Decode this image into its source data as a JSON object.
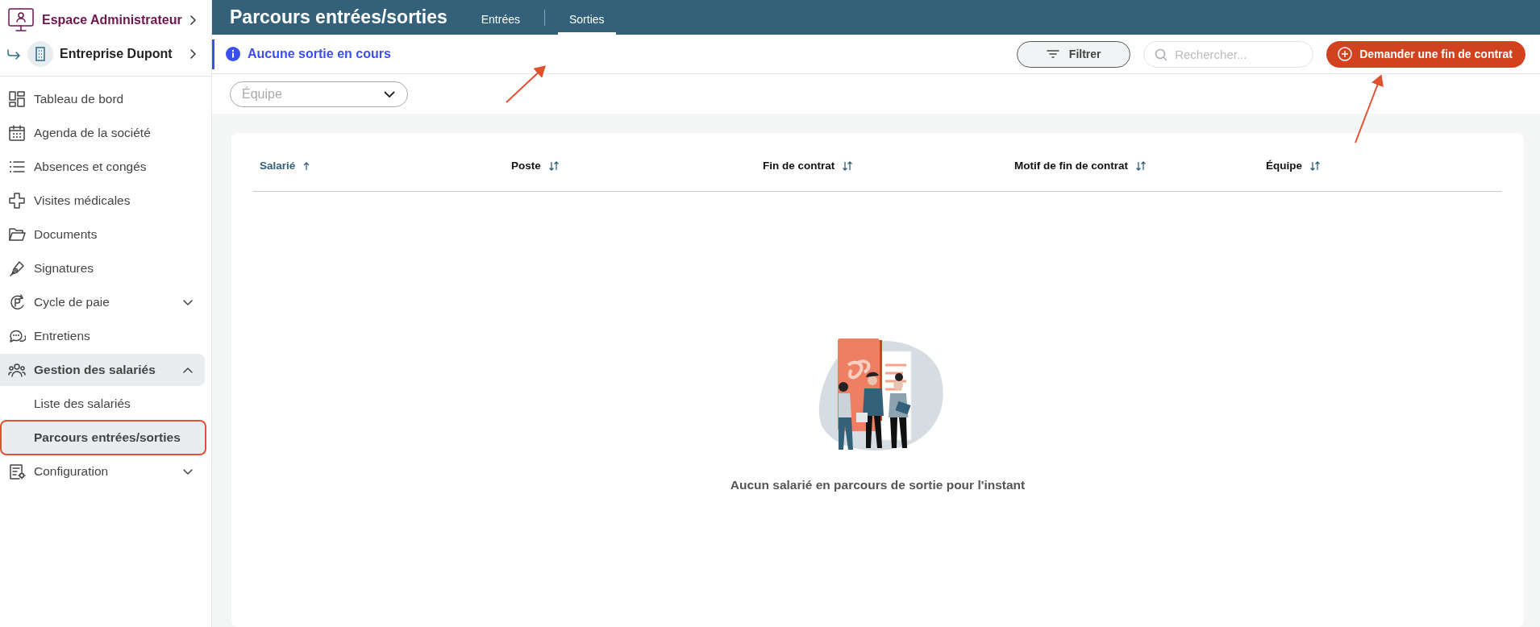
{
  "sidebar": {
    "workspace": {
      "label": "Espace Administrateur"
    },
    "company": {
      "label": "Entreprise Dupont"
    },
    "items": [
      {
        "kind": "link",
        "label": "Tableau de bord",
        "selected": false
      },
      {
        "kind": "link",
        "label": "Agenda de la société",
        "selected": false
      },
      {
        "kind": "link",
        "label": "Absences et congés",
        "selected": false
      },
      {
        "kind": "link",
        "label": "Visites médicales",
        "selected": false
      },
      {
        "kind": "link",
        "label": "Documents",
        "selected": false
      },
      {
        "kind": "link",
        "label": "Signatures",
        "selected": false
      },
      {
        "kind": "group",
        "label": "Cycle de paie",
        "expanded": false
      },
      {
        "kind": "link",
        "label": "Entretiens",
        "selected": false
      },
      {
        "kind": "group",
        "label": "Gestion des salariés",
        "expanded": true,
        "children": [
          {
            "label": "Liste des salariés",
            "selected": false,
            "highlighted": false
          },
          {
            "label": "Parcours entrées/sorties",
            "selected": true,
            "highlighted": true
          }
        ]
      },
      {
        "kind": "group",
        "label": "Configuration",
        "expanded": false
      }
    ]
  },
  "header": {
    "title": "Parcours entrées/sorties",
    "tabs": [
      {
        "label": "Entrées",
        "selected": false
      },
      {
        "label": "Sorties",
        "selected": true
      }
    ]
  },
  "info": {
    "message": "Aucune sortie en cours"
  },
  "toolbar": {
    "filter_button": "Filtrer",
    "search": {
      "placeholder": "Rechercher..."
    },
    "primary_button": "Demander une fin de contrat"
  },
  "filters": {
    "team": {
      "placeholder": "Équipe"
    }
  },
  "table": {
    "columns": [
      {
        "label": "Salarié",
        "sorted": true
      },
      {
        "label": "Poste",
        "sorted": false
      },
      {
        "label": "Fin de contrat",
        "sorted": false
      },
      {
        "label": "Motif de fin de contrat",
        "sorted": false
      },
      {
        "label": "Équipe",
        "sorted": false
      }
    ],
    "empty_message": "Aucun salarié en parcours de sortie pour l'instant"
  }
}
